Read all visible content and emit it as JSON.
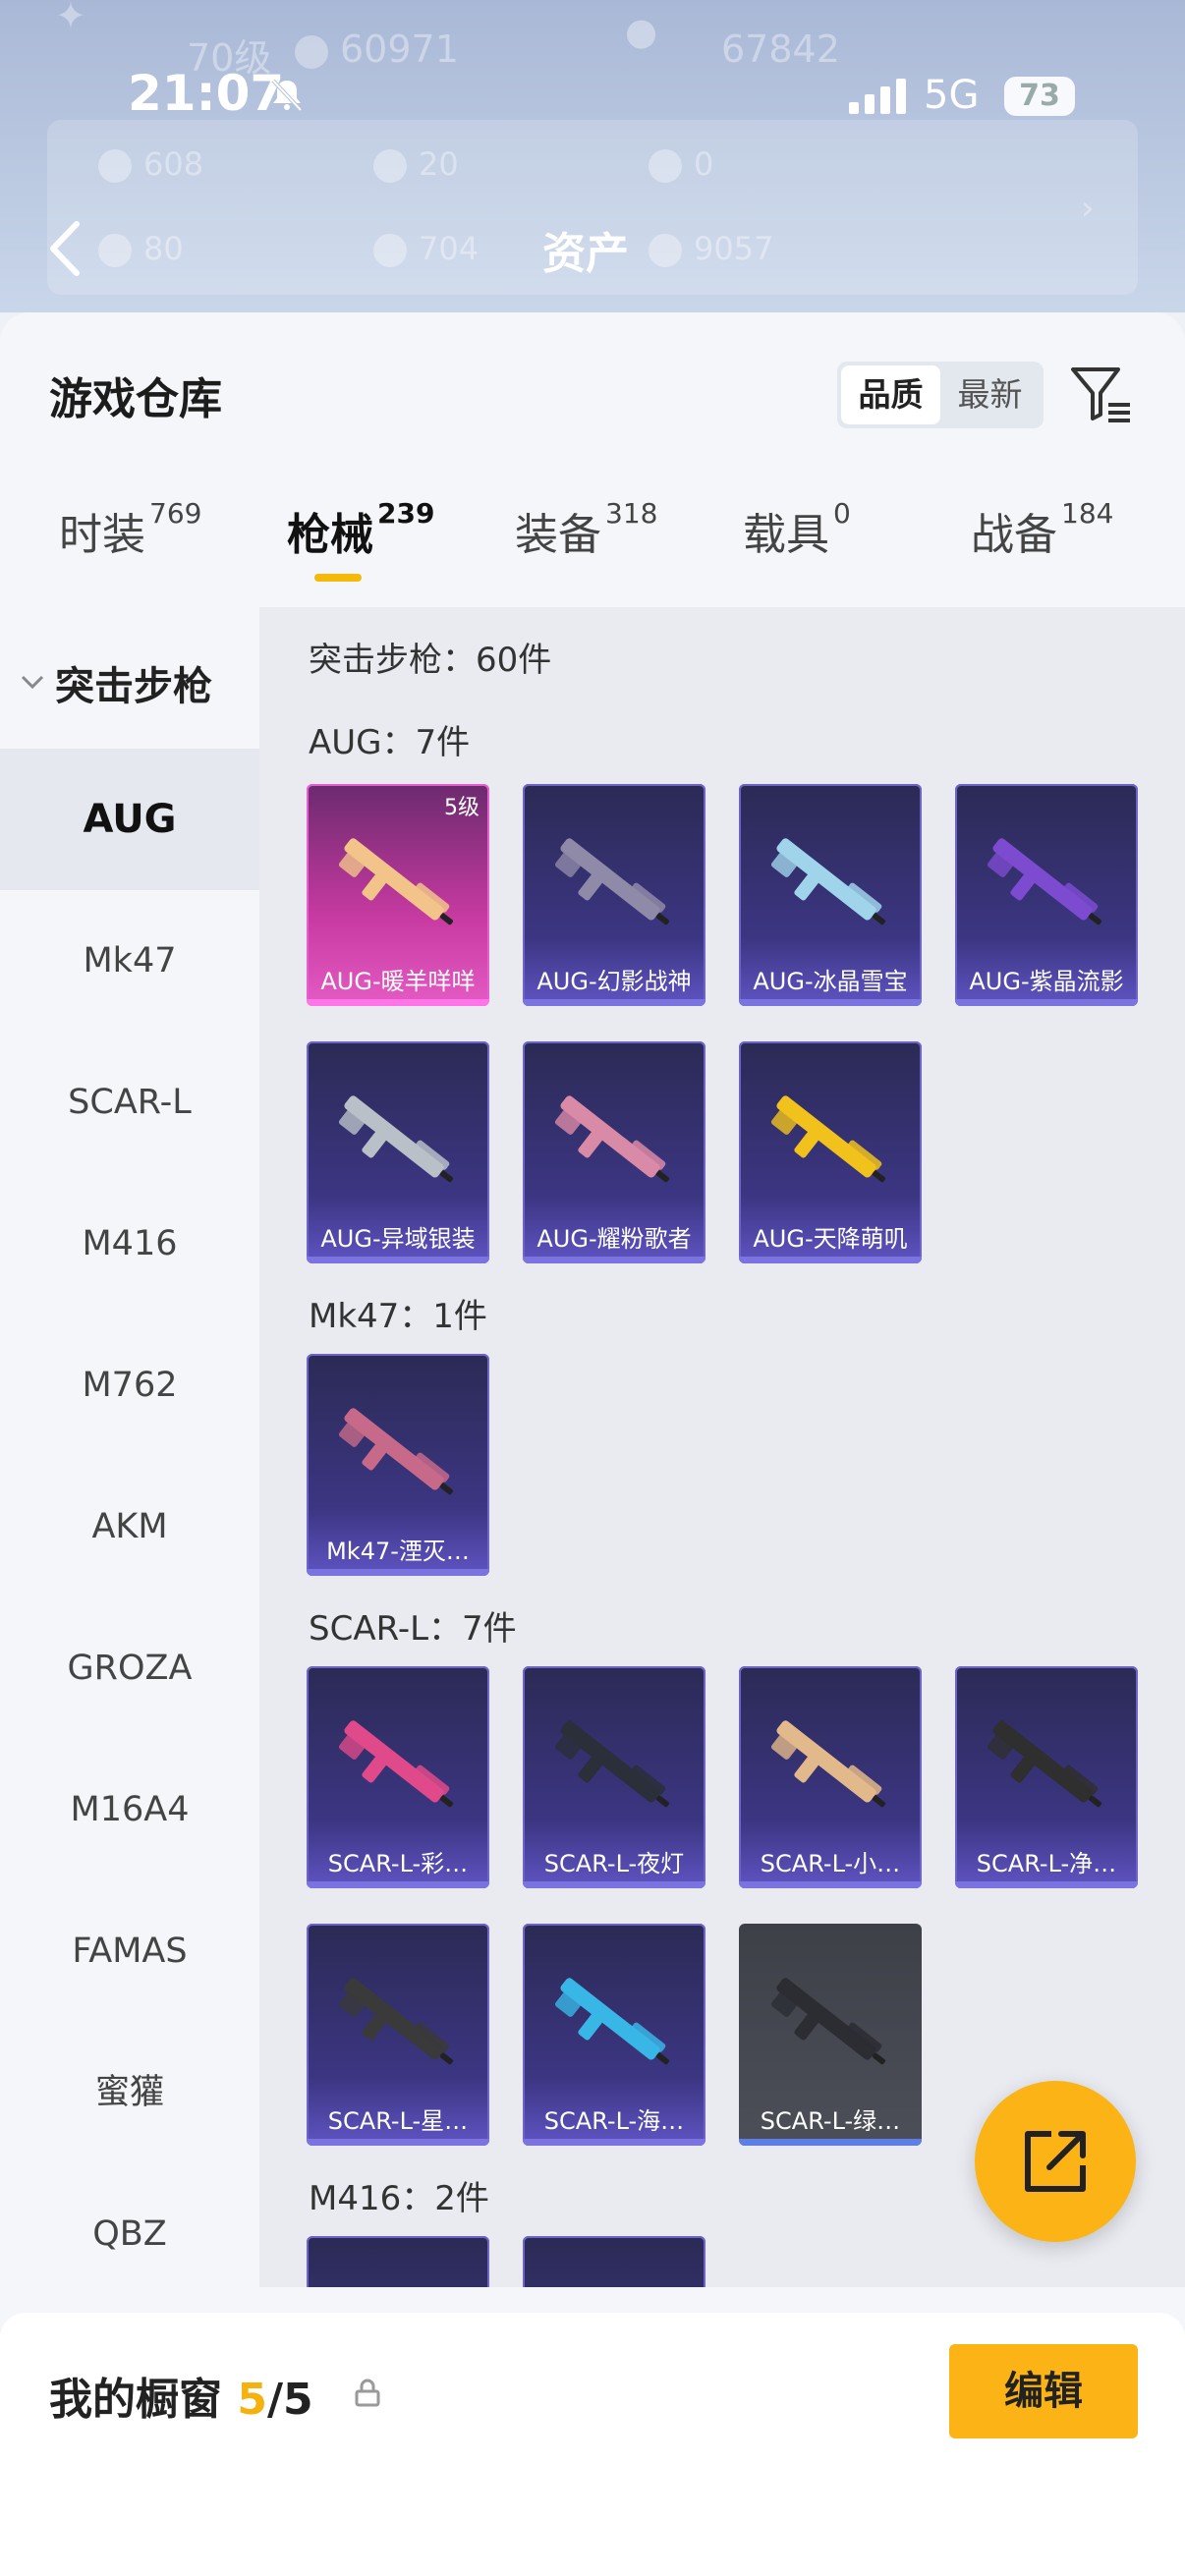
{
  "status_bar": {
    "time": "21:07",
    "network": "5G",
    "battery": "73"
  },
  "header": {
    "title": "资产",
    "ghost_level": "70级",
    "ghost_coins": "60971",
    "ghost_points": "67842",
    "ghost_stats": [
      "608",
      "20",
      "0",
      "80",
      "704",
      "9057"
    ]
  },
  "sheet": {
    "title": "游戏仓库",
    "sort": [
      "品质",
      "最新"
    ]
  },
  "tabs": [
    {
      "label": "时装",
      "count": "769"
    },
    {
      "label": "枪械",
      "count": "239"
    },
    {
      "label": "装备",
      "count": "318"
    },
    {
      "label": "载具",
      "count": "0"
    },
    {
      "label": "战备",
      "count": "184"
    }
  ],
  "side": {
    "category": "突击步枪",
    "items": [
      "AUG",
      "Mk47",
      "SCAR-L",
      "M416",
      "M762",
      "AKM",
      "GROZA",
      "M16A4",
      "FAMAS",
      "蜜獾",
      "QBZ"
    ]
  },
  "content": {
    "summary": "突击步枪：60件",
    "sections": [
      {
        "title": "AUG：7件",
        "items": [
          {
            "name": "AUG-暖羊咩咩",
            "level": "5级",
            "style": "pink"
          },
          {
            "name": "AUG-幻影战神"
          },
          {
            "name": "AUG-冰晶雪宝"
          },
          {
            "name": "AUG-紫晶流影"
          },
          {
            "name": "AUG-异域银装"
          },
          {
            "name": "AUG-耀粉歌者"
          },
          {
            "name": "AUG-天降萌叽"
          }
        ]
      },
      {
        "title": "Mk47：1件",
        "items": [
          {
            "name": "Mk47-湮灭…"
          }
        ]
      },
      {
        "title": "SCAR-L：7件",
        "items": [
          {
            "name": "SCAR-L-彩…"
          },
          {
            "name": "SCAR-L-夜灯"
          },
          {
            "name": "SCAR-L-小…"
          },
          {
            "name": "SCAR-L-净…"
          },
          {
            "name": "SCAR-L-星…"
          },
          {
            "name": "SCAR-L-海…"
          },
          {
            "name": "SCAR-L-绿…",
            "style": "gray"
          }
        ]
      },
      {
        "title": "M416：2件",
        "items": [
          {
            "name": ""
          },
          {
            "name": ""
          }
        ]
      }
    ]
  },
  "bottom": {
    "label": "我的橱窗",
    "count": "5",
    "total": "/5",
    "edit": "编辑"
  },
  "colors": {
    "accent": "#fbb316",
    "card_purple": "#3c3683",
    "card_pink": "#c73aa1"
  }
}
